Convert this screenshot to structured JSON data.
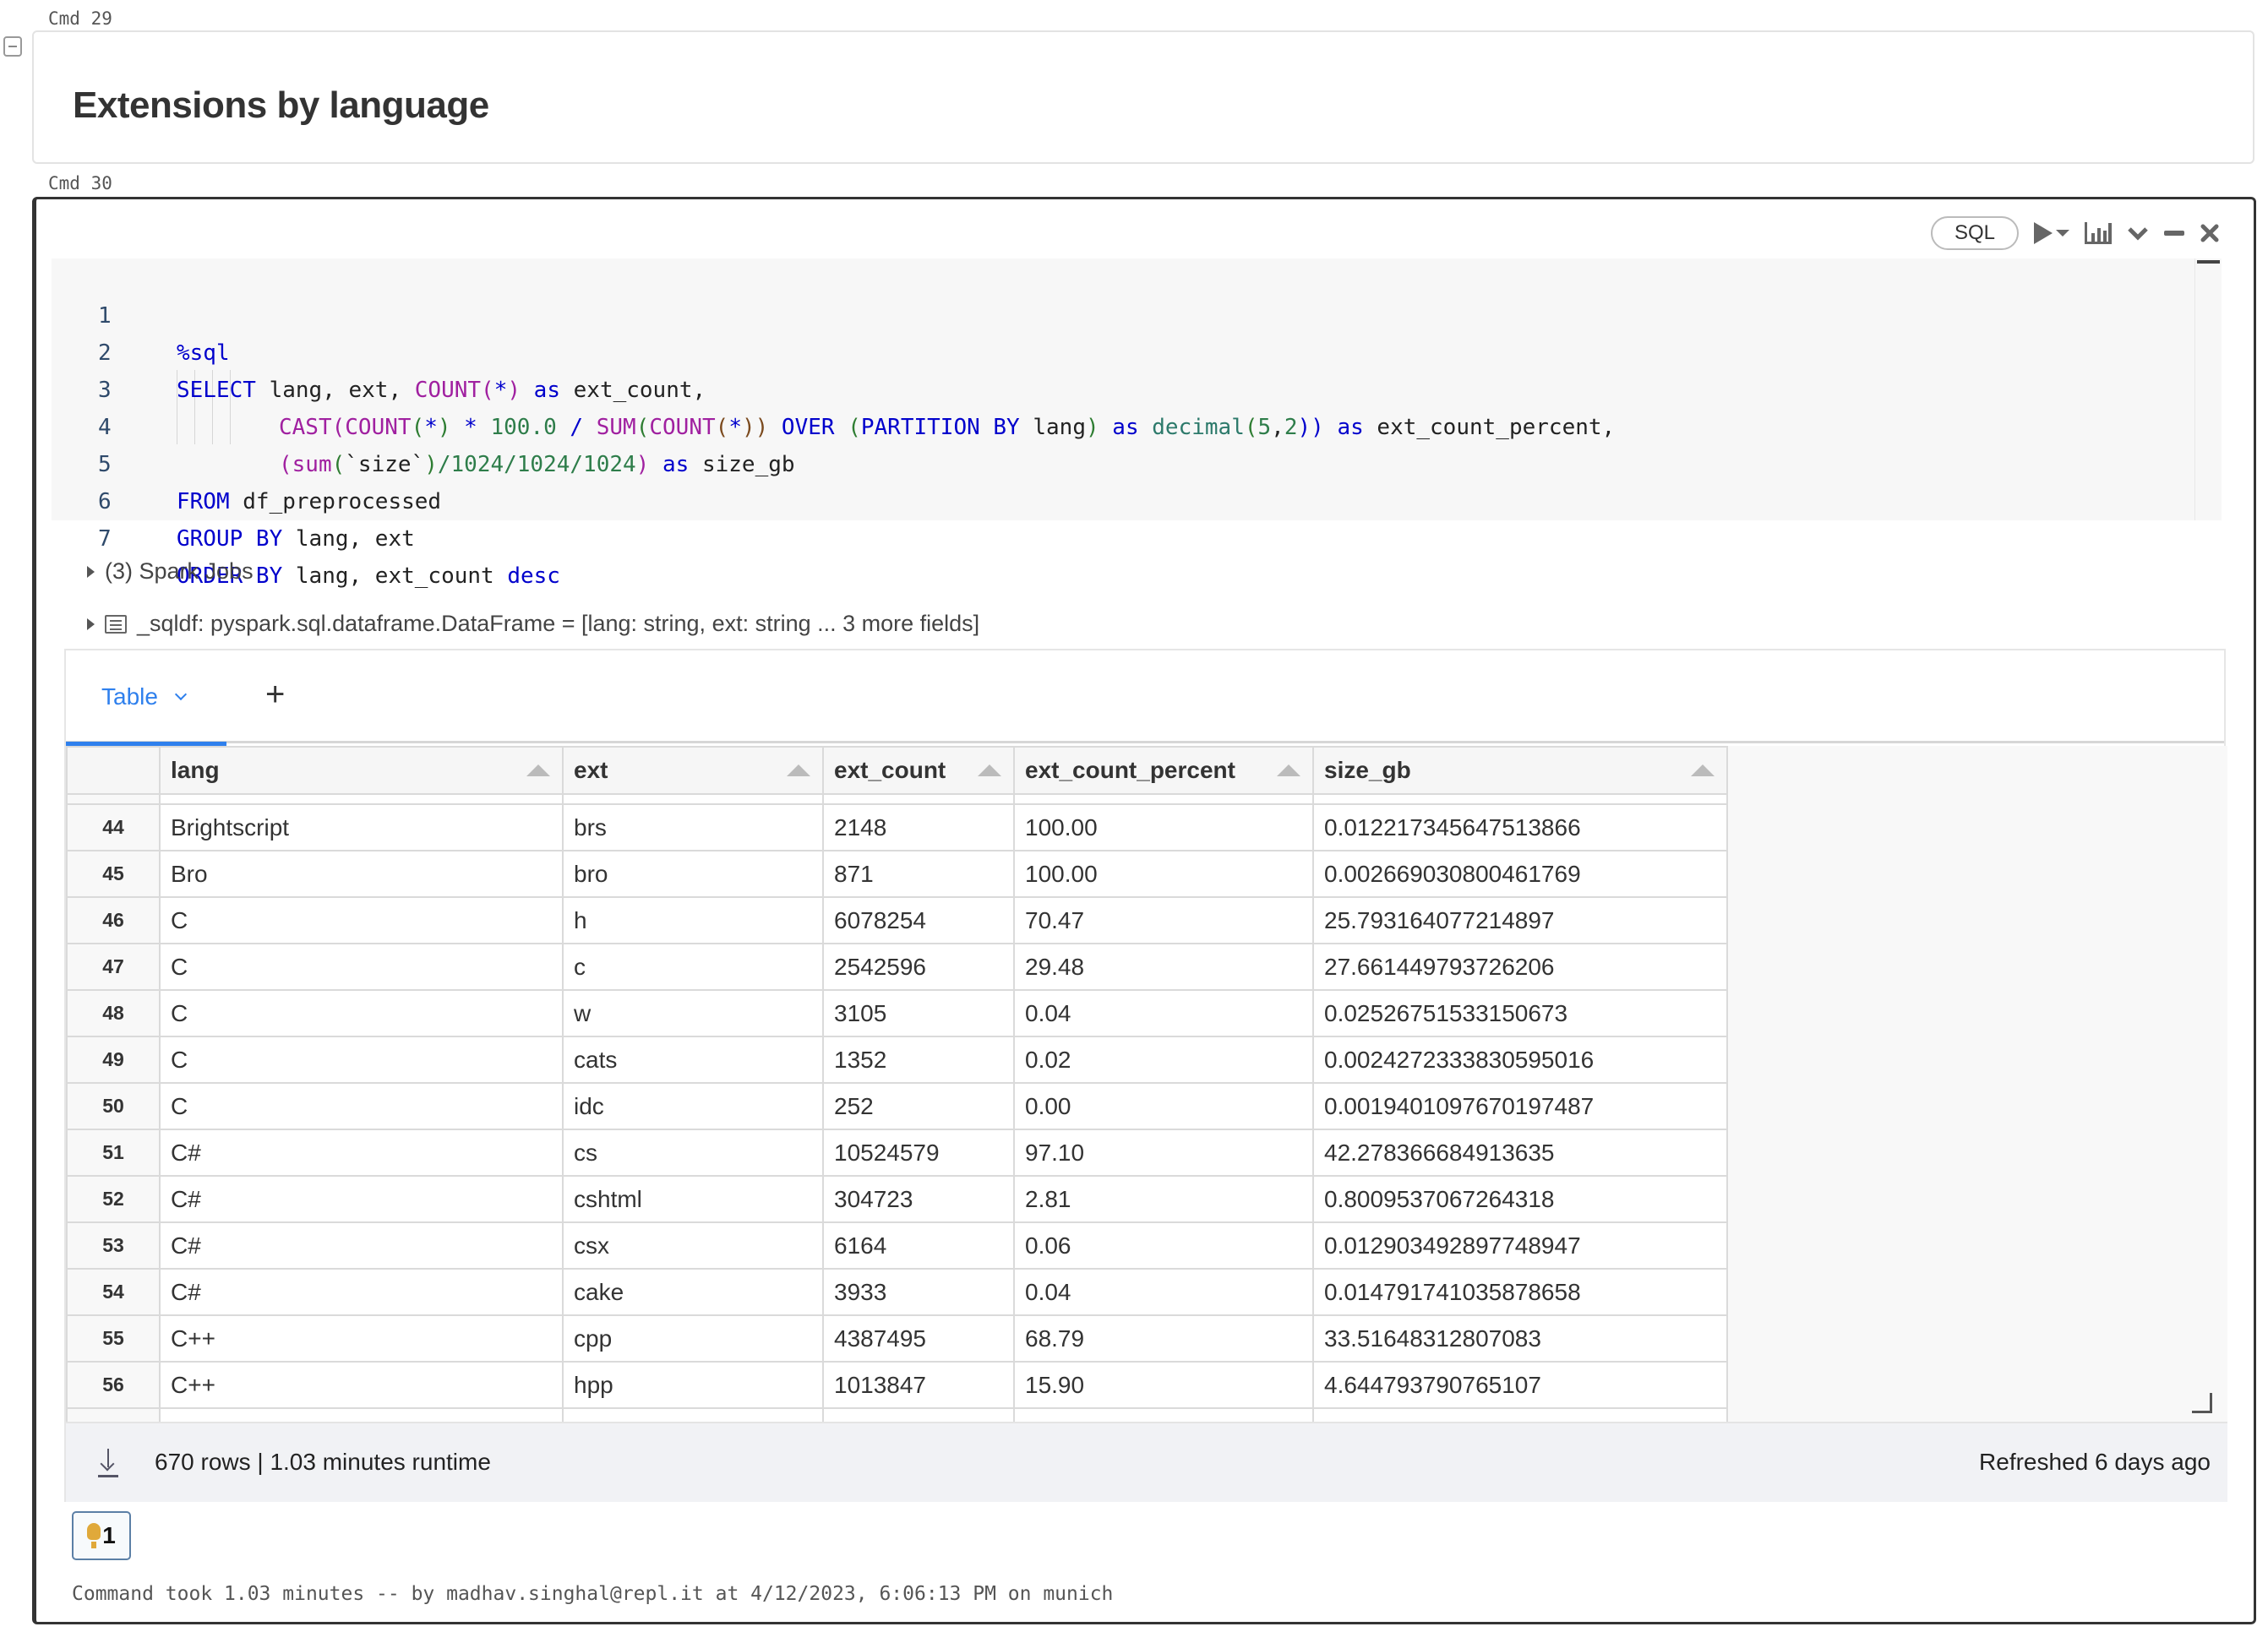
{
  "cells": {
    "markdown": {
      "cmd_label": "Cmd 29",
      "title": "Extensions by language"
    },
    "code": {
      "cmd_label": "Cmd 30",
      "language_badge": "SQL",
      "toolbar_icons": [
        "run-icon",
        "run-menu-caret-icon",
        "chart-icon",
        "chevron-down-icon",
        "minimize-icon",
        "close-icon"
      ],
      "code_lines": [
        {
          "n": "1"
        },
        {
          "n": "2"
        },
        {
          "n": "3"
        },
        {
          "n": "4"
        },
        {
          "n": "5"
        },
        {
          "n": "6"
        },
        {
          "n": "7"
        }
      ],
      "code_tokens": {
        "l1": [
          "%sql"
        ],
        "l2": [
          "SELECT",
          " lang, ext, ",
          "COUNT",
          "(",
          "*",
          ")",
          " as",
          " ext_count,"
        ],
        "l3": [
          "CAST",
          "(",
          "COUNT",
          "(",
          "*",
          ")",
          " * ",
          "100.0",
          " / ",
          "SUM",
          "(",
          "COUNT",
          "(",
          "*",
          "))",
          " OVER",
          " (",
          "PARTITION BY",
          " lang",
          ")",
          " as",
          " decimal",
          "(",
          "5",
          ",",
          "2",
          "))",
          " as",
          " ext_count_percent,"
        ],
        "l4": [
          "(",
          "sum",
          "(",
          "`size`",
          ")",
          "/1024/1024/1024",
          ")",
          " as",
          " size_gb"
        ],
        "l5": [
          "FROM",
          " df_preprocessed"
        ],
        "l6": [
          "GROUP BY",
          " lang, ext"
        ],
        "l7": [
          "ORDER BY",
          " lang, ext_count ",
          "desc"
        ]
      },
      "spark_jobs": "(3) Spark Jobs",
      "sqldf": "_sqldf:  pyspark.sql.dataframe.DataFrame = [lang: string, ext: string ... 3 more fields]",
      "result": {
        "tab_label": "Table",
        "add_tab_label": "+",
        "columns": [
          "lang",
          "ext",
          "ext_count",
          "ext_count_percent",
          "size_gb"
        ],
        "rows": [
          {
            "idx": "44",
            "lang": "Brightscript",
            "ext": "brs",
            "ext_count": "2148",
            "ext_count_percent": "100.00",
            "size_gb": "0.012217345647513866"
          },
          {
            "idx": "45",
            "lang": "Bro",
            "ext": "bro",
            "ext_count": "871",
            "ext_count_percent": "100.00",
            "size_gb": "0.002669030800461769"
          },
          {
            "idx": "46",
            "lang": "C",
            "ext": "h",
            "ext_count": "6078254",
            "ext_count_percent": "70.47",
            "size_gb": "25.793164077214897"
          },
          {
            "idx": "47",
            "lang": "C",
            "ext": "c",
            "ext_count": "2542596",
            "ext_count_percent": "29.48",
            "size_gb": "27.661449793726206"
          },
          {
            "idx": "48",
            "lang": "C",
            "ext": "w",
            "ext_count": "3105",
            "ext_count_percent": "0.04",
            "size_gb": "0.02526751533150673"
          },
          {
            "idx": "49",
            "lang": "C",
            "ext": "cats",
            "ext_count": "1352",
            "ext_count_percent": "0.02",
            "size_gb": "0.0024272333830595016"
          },
          {
            "idx": "50",
            "lang": "C",
            "ext": "idc",
            "ext_count": "252",
            "ext_count_percent": "0.00",
            "size_gb": "0.0019401097670197487"
          },
          {
            "idx": "51",
            "lang": "C#",
            "ext": "cs",
            "ext_count": "10524579",
            "ext_count_percent": "97.10",
            "size_gb": "42.278366684913635"
          },
          {
            "idx": "52",
            "lang": "C#",
            "ext": "cshtml",
            "ext_count": "304723",
            "ext_count_percent": "2.81",
            "size_gb": "0.8009537067264318"
          },
          {
            "idx": "53",
            "lang": "C#",
            "ext": "csx",
            "ext_count": "6164",
            "ext_count_percent": "0.06",
            "size_gb": "0.012903492897748947"
          },
          {
            "idx": "54",
            "lang": "C#",
            "ext": "cake",
            "ext_count": "3933",
            "ext_count_percent": "0.04",
            "size_gb": "0.014791741035878658"
          },
          {
            "idx": "55",
            "lang": "C++",
            "ext": "cpp",
            "ext_count": "4387495",
            "ext_count_percent": "68.79",
            "size_gb": "33.51648312807083"
          },
          {
            "idx": "56",
            "lang": "C++",
            "ext": "hpp",
            "ext_count": "1013847",
            "ext_count_percent": "15.90",
            "size_gb": "4.644793790765107"
          }
        ],
        "status": {
          "summary": "670 rows  |  1.03 minutes runtime",
          "refreshed": "Refreshed 6 days ago"
        }
      },
      "hint_count": "1",
      "footer": "Command took 1.03 minutes -- by madhav.singhal@repl.it at 4/12/2023, 6:06:13 PM on munich"
    }
  },
  "colors": {
    "accent": "#2f80ed",
    "keyword": "#0000cc",
    "function": "#a020a0",
    "number": "#2e7d4a",
    "bulb": "#e0a93a"
  }
}
